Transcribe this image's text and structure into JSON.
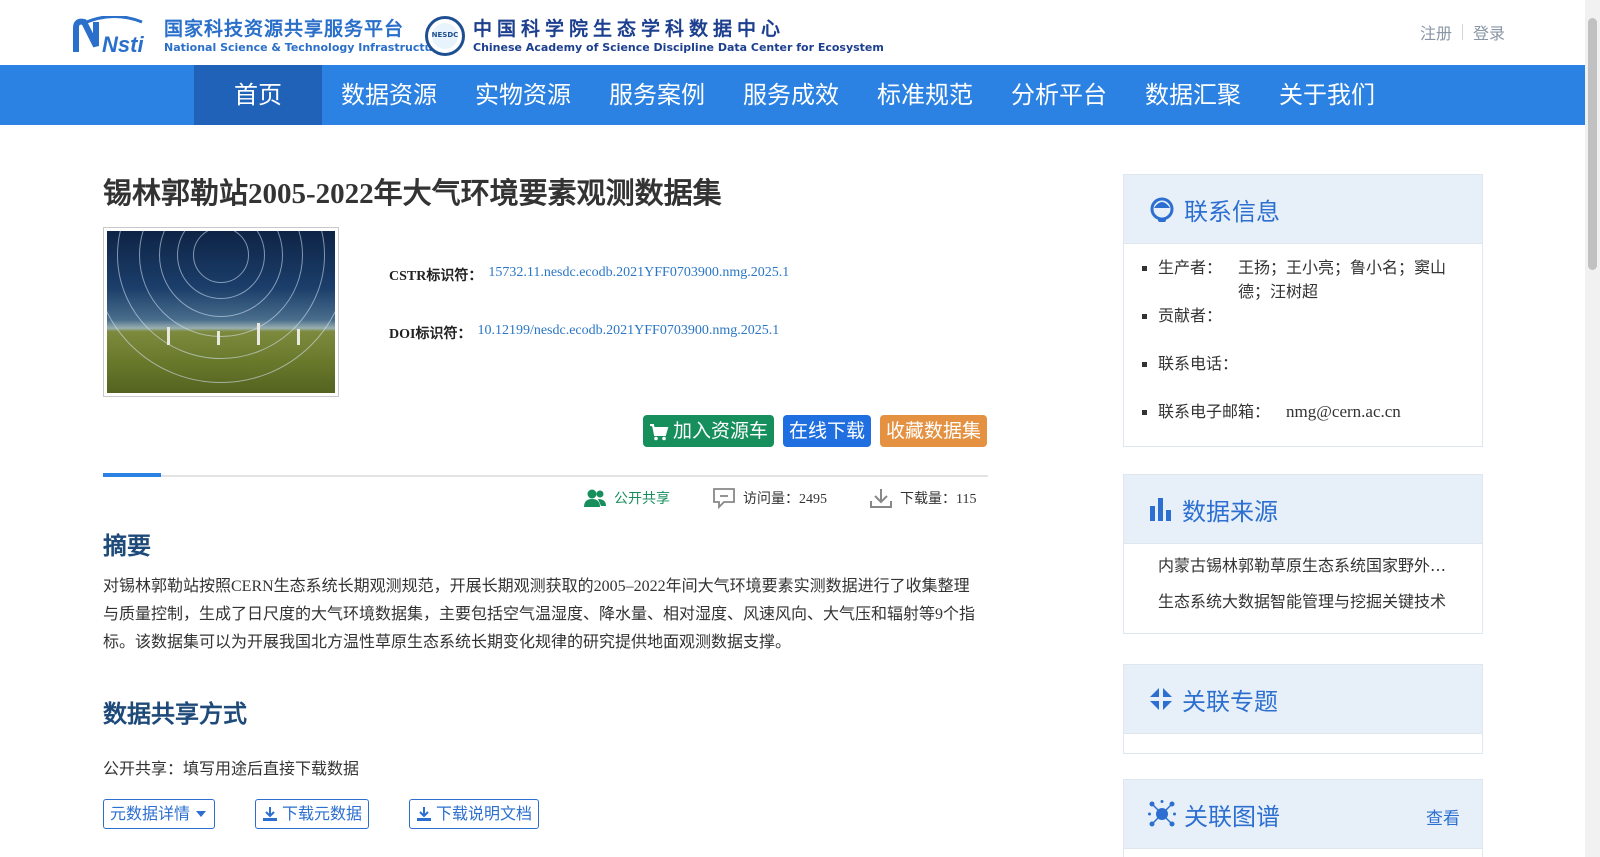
{
  "header": {
    "logo_nsti": {
      "mark": "Nsti",
      "cn": "国家科技资源共享服务平台",
      "en": "National Science & Technology Infrastructure"
    },
    "logo_nesdc": {
      "badge": "NESDC",
      "cn": "中国科学院生态学科数据中心",
      "en": "Chinese Academy of Science Discipline Data Center for Ecosystem"
    },
    "register": "注册",
    "login": "登录"
  },
  "nav": {
    "items": [
      {
        "label": "首页",
        "active": true
      },
      {
        "label": "数据资源"
      },
      {
        "label": "实物资源"
      },
      {
        "label": "服务案例"
      },
      {
        "label": "服务成效"
      },
      {
        "label": "标准规范"
      },
      {
        "label": "分析平台"
      },
      {
        "label": "数据汇聚"
      },
      {
        "label": "关于我们"
      }
    ]
  },
  "dataset": {
    "title": "锡林郭勒站2005-2022年大气环境要素观测数据集",
    "cstr_label": "CSTR标识符：",
    "cstr_value": "15732.11.nesdc.ecodb.2021YFF0703900.nmg.2025.1",
    "doi_label": "DOI标识符：",
    "doi_value": "10.12199/nesdc.ecodb.2021YFF0703900.nmg.2025.1"
  },
  "actions": {
    "add_cart": "加入资源车",
    "download": "在线下载",
    "favorite": "收藏数据集"
  },
  "stats": {
    "open_share": "公开共享",
    "visits": "访问量：2495",
    "downloads": "下载量：115"
  },
  "abstract": {
    "heading": "摘要",
    "text": "对锡林郭勒站按照CERN生态系统长期观测规范，开展长期观测获取的2005–2022年间大气环境要素实测数据进行了收集整理与质量控制，生成了日尺度的大气环境数据集，主要包括空气温湿度、降水量、相对湿度、风速风向、大气压和辐射等9个指标。该数据集可以为开展我国北方温性草原生态系统长期变化规律的研究提供地面观测数据支撑。"
  },
  "sharing": {
    "heading": "数据共享方式",
    "text": "公开共享：填写用途后直接下载数据"
  },
  "tools": {
    "metadata_detail": "元数据详情",
    "download_metadata": "下载元数据",
    "download_doc": "下载说明文档"
  },
  "sidebar": {
    "contact": {
      "title": "联系信息",
      "producer_label": "生产者：",
      "producer_value": "王扬；王小亮；鲁小名；窦山德；汪树超",
      "contributor_label": "贡献者：",
      "phone_label": "联系电话：",
      "email_label": "联系电子邮箱：",
      "email_value": "nmg@cern.ac.cn"
    },
    "source": {
      "title": "数据来源",
      "items": [
        "内蒙古锡林郭勒草原生态系统国家野外科学观测研究站",
        "生态系统大数据智能管理与挖掘关键技术"
      ]
    },
    "topics": {
      "title": "关联专题"
    },
    "graph": {
      "title": "关联图谱",
      "more": "查看"
    }
  },
  "colors": {
    "nav_bg": "#2c82e2",
    "nav_active": "#1f62b8",
    "green": "#168f5c",
    "blue": "#1f6fe0",
    "orange": "#e49142"
  }
}
